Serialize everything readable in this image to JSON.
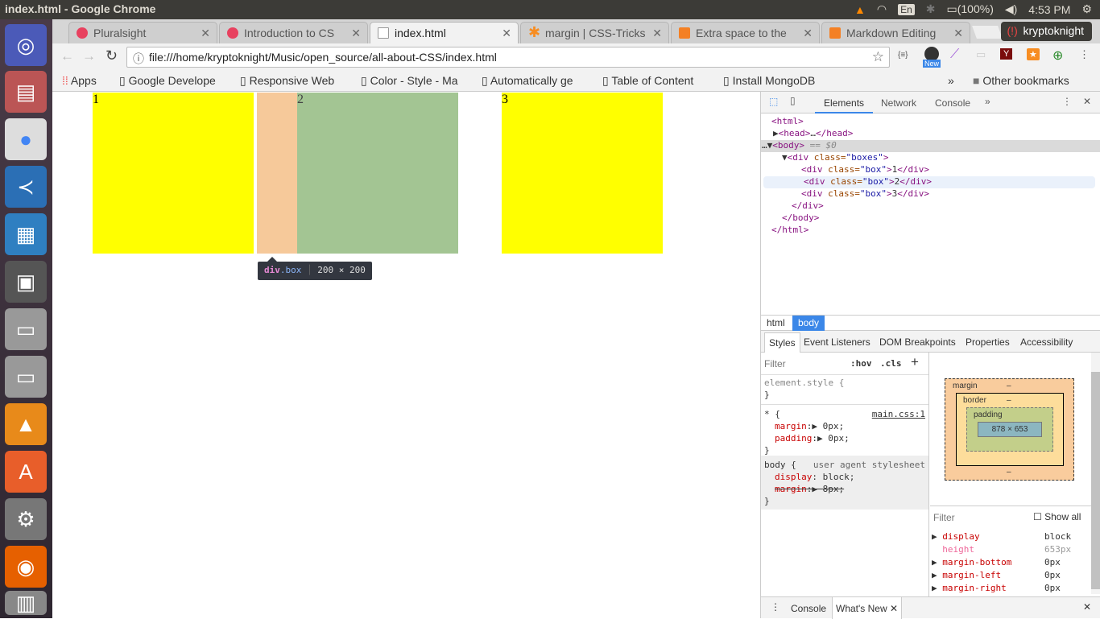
{
  "window_title": "index.html - Google Chrome",
  "tray": {
    "lang": "En",
    "battery": "(100%)",
    "time": "4:53 PM"
  },
  "tabs": [
    {
      "label": "Pluralsight",
      "color": "#e8415f"
    },
    {
      "label": "Introduction to CS",
      "color": "#e8415f"
    },
    {
      "label": "index.html",
      "color": "#ffffff"
    },
    {
      "label": "margin | CSS-Tricks",
      "color": "#f78d22"
    },
    {
      "label": "Extra space to the",
      "color": "#f48024"
    },
    {
      "label": "Markdown Editing",
      "color": "#f48024"
    }
  ],
  "profile": "kryptoknight",
  "address": "file:///home/kryptoknight/Music/open_source/all-about-CSS/index.html",
  "extension_badge": "New",
  "bookmarks": [
    "Apps",
    "Google Develope",
    "Responsive Web",
    "Color - Style - Ma",
    "Automatically ge",
    "Table of Content",
    "Install MongoDB"
  ],
  "bookmarks_overflow": "»",
  "other_bookmarks": "Other bookmarks",
  "page": {
    "boxes": [
      "1",
      "2",
      "3"
    ],
    "box_color": "#ffff00",
    "highlight_margin": "#f6c99a",
    "highlight_content": "#a3c593",
    "tooltip": {
      "tag": "div",
      "cls": ".box",
      "size": "200 × 200"
    }
  },
  "devtools": {
    "tabs": [
      "Elements",
      "Network",
      "Console",
      "»"
    ],
    "dom": {
      "l1": "<html>",
      "l2a": "<head>",
      "l2b": "…",
      "l2c": "</head>",
      "l3a": "<body>",
      "l3b": " == $0",
      "div_open": "<div",
      "class_attr": " class=",
      "boxes_val": "\"boxes\"",
      "gt": ">",
      "box_val": "\"box\"",
      "c1": "1",
      "c2": "2",
      "c3": "3",
      "div_close": "</div>",
      "body_close": "</body>",
      "html_close": "</html>"
    },
    "breadcrumbs": [
      "html",
      "body"
    ],
    "subtabs": [
      "Styles",
      "Event Listeners",
      "DOM Breakpoints",
      "Properties",
      "Accessibility"
    ],
    "filter": "Filter",
    "hov": ":hov",
    "cls": ".cls",
    "rules": {
      "element_style": "element.style {",
      "close": "}",
      "star": "* {",
      "star_src": "main.css:1",
      "p1": "margin",
      "v1": "0px;",
      "p2": "padding",
      "v2": "0px;",
      "body": "body {",
      "body_src": "user agent stylesheet",
      "p3": "display",
      "v3": "block;",
      "p4": "margin",
      "v4": "8px;"
    },
    "boxmodel": {
      "margin": "margin",
      "border": "border",
      "padding": "padding",
      "content": "878 × 653",
      "dash": "–"
    },
    "computed": {
      "filter": "Filter",
      "show_all": "Show all",
      "props": [
        [
          "display",
          "block"
        ],
        [
          "height",
          "653px"
        ],
        [
          "margin-bottom",
          "0px"
        ],
        [
          "margin-left",
          "0px"
        ],
        [
          "margin-right",
          "0px"
        ]
      ]
    },
    "drawer": {
      "tabs": [
        "Console",
        "What's New"
      ]
    }
  }
}
